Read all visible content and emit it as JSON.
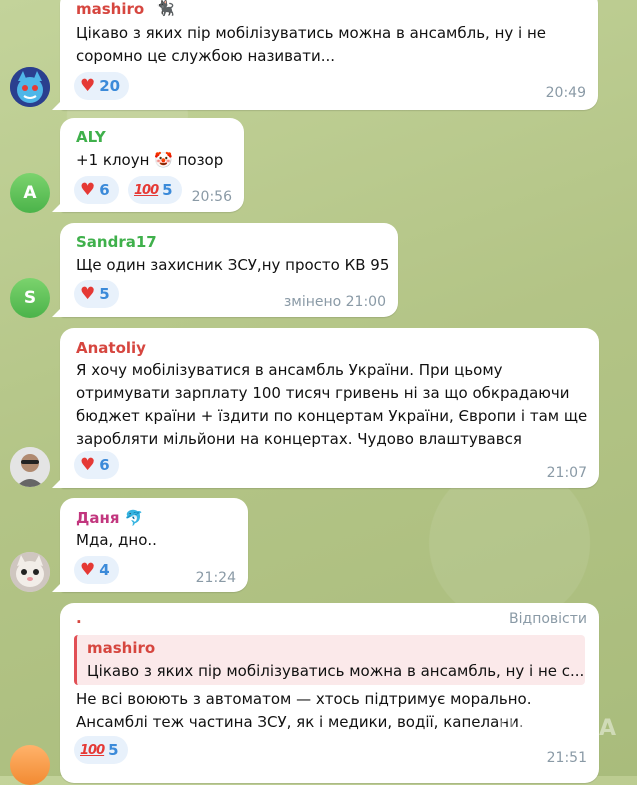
{
  "messages": [
    {
      "sender": "mashiro",
      "sender_color": "#d6463f",
      "text": "Цікаво з яких пір мобілізуватись можна в ансамбль, ну і не\nсоромно це службою називати...",
      "reactions": [
        {
          "icon": "heart-icon",
          "count": "20"
        }
      ],
      "time": "20:49"
    },
    {
      "sender": "ALY",
      "sender_color": "#3fb04b",
      "avatar_letter": "A",
      "text": "+1 клоун 🤡 позор",
      "reactions": [
        {
          "icon": "heart-icon",
          "count": "6"
        },
        {
          "icon": "hundred-icon",
          "count": "5"
        }
      ],
      "time": "20:56"
    },
    {
      "sender": "Sandra17",
      "sender_color": "#3fb04b",
      "avatar_letter": "S",
      "text": "Ще один захисник ЗСУ,ну просто КВ 95",
      "reactions": [
        {
          "icon": "heart-icon",
          "count": "5"
        }
      ],
      "time": "змінено 21:00"
    },
    {
      "sender": "Anatoliy",
      "sender_color": "#d6463f",
      "text": "Я хочу мобілізуватися в ансамбль України. При цьому\nотримувати зарплату 100 тисяч гривень ні за що обкрадаючи\nбюджет країни + їздити по концертам України, Європи і там ще\nзаробляти мільйони на концертах. Чудово влаштувався",
      "reactions": [
        {
          "icon": "heart-icon",
          "count": "6"
        }
      ],
      "time": "21:07"
    },
    {
      "sender": "Даня 🐬",
      "sender_color": "#c2367e",
      "text": "Мда, дно..",
      "reactions": [
        {
          "icon": "heart-icon",
          "count": "4"
        }
      ],
      "time": "21:24"
    },
    {
      "sender": ".",
      "sender_color": "#d6463f",
      "reply_label": "Відповісти",
      "quote_sender": "mashiro",
      "quote_text": "Цікаво з яких пір мобілізуватись можна в ансамбль, ну і не с...",
      "text": "Не всі воюють з автоматом — хтось підтримує морально.\nАнсамблі теж частина ЗСУ, як і медики, водії, капелани.",
      "reactions": [
        {
          "icon": "hundred-icon",
          "count": "5"
        }
      ],
      "time": "21:51"
    }
  ],
  "watermark": "OBOZ.UA"
}
